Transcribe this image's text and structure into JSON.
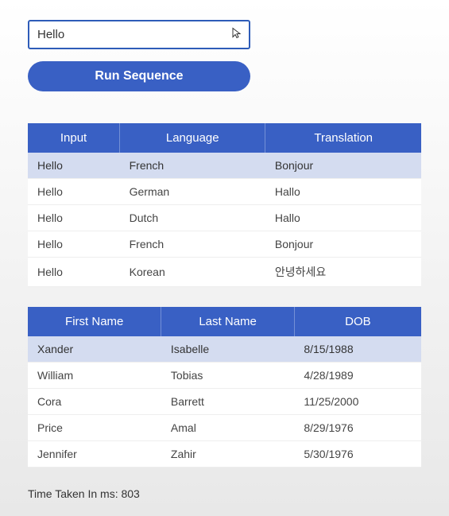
{
  "input": {
    "value": "Hello"
  },
  "button": {
    "run_label": "Run Sequence"
  },
  "translation_table": {
    "headers": [
      "Input",
      "Language",
      "Translation"
    ],
    "rows": [
      {
        "input": "Hello",
        "language": "French",
        "translation": "Bonjour"
      },
      {
        "input": "Hello",
        "language": "German",
        "translation": "Hallo"
      },
      {
        "input": "Hello",
        "language": "Dutch",
        "translation": "Hallo"
      },
      {
        "input": "Hello",
        "language": "French",
        "translation": "Bonjour"
      },
      {
        "input": "Hello",
        "language": "Korean",
        "translation": "안녕하세요"
      }
    ]
  },
  "people_table": {
    "headers": [
      "First Name",
      "Last Name",
      "DOB"
    ],
    "rows": [
      {
        "first_name": "Xander",
        "last_name": "Isabelle",
        "dob": "8/15/1988"
      },
      {
        "first_name": "William",
        "last_name": "Tobias",
        "dob": "4/28/1989"
      },
      {
        "first_name": "Cora",
        "last_name": "Barrett",
        "dob": "11/25/2000"
      },
      {
        "first_name": "Price",
        "last_name": "Amal",
        "dob": "8/29/1976"
      },
      {
        "first_name": "Jennifer",
        "last_name": "Zahir",
        "dob": "5/30/1976"
      }
    ]
  },
  "status": {
    "time_label": "Time Taken In ms: ",
    "time_value": "803"
  }
}
